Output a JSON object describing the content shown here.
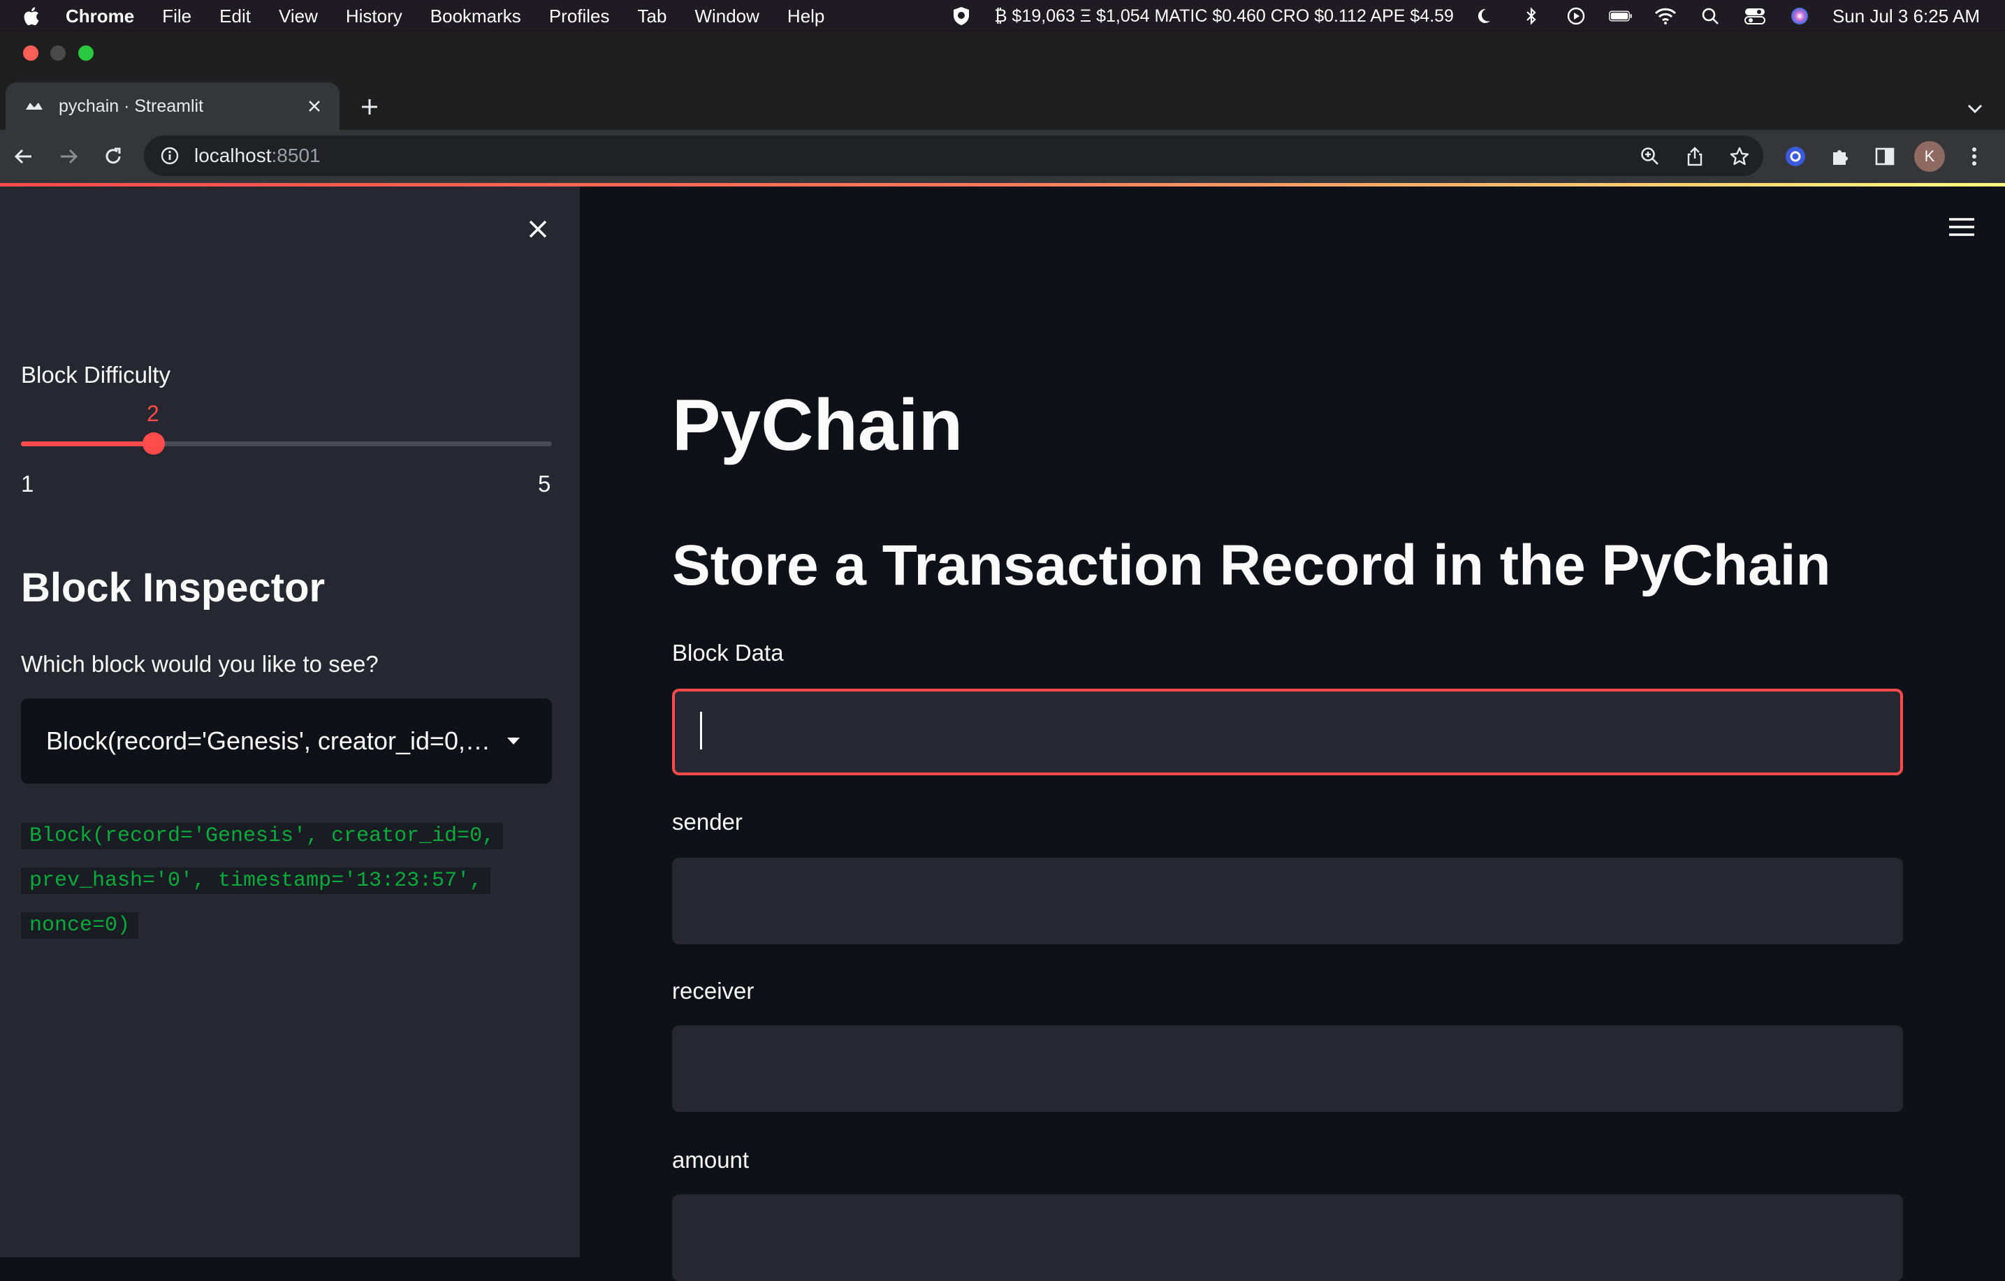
{
  "menubar": {
    "app_name": "Chrome",
    "items": [
      "File",
      "Edit",
      "View",
      "History",
      "Bookmarks",
      "Profiles",
      "Tab",
      "Window",
      "Help"
    ],
    "ticker": "₿ $19,063 Ξ $1,054 MATIC $0.460 CRO $0.112 APE $4.59",
    "clock": "Sun Jul 3  6:25 AM"
  },
  "browser": {
    "tab_title": "pychain · Streamlit",
    "url_host": "localhost",
    "url_port": ":8501",
    "avatar_initial": "K"
  },
  "sidebar": {
    "difficulty_label": "Block Difficulty",
    "difficulty_value": "2",
    "difficulty_min": "1",
    "difficulty_max": "5",
    "difficulty_fraction": 0.25,
    "inspector_heading": "Block Inspector",
    "select_label": "Which block would you like to see?",
    "select_value": "Block(record='Genesis', creator_id=0, prev_hash='0', timestamp='13:23:57', nonce=0)",
    "code_lines": [
      "Block(record='Genesis', creator_id=0,",
      "prev_hash='0', timestamp='13:23:57',",
      "nonce=0)"
    ]
  },
  "main": {
    "title": "PyChain",
    "subtitle": "Store a Transaction Record in the PyChain",
    "fields": [
      {
        "label": "Block Data",
        "value": ""
      },
      {
        "label": "sender",
        "value": ""
      },
      {
        "label": "receiver",
        "value": ""
      },
      {
        "label": "amount",
        "value": ""
      }
    ]
  },
  "colors": {
    "accent": "#ff4b4b",
    "background": "#0e1117",
    "sidebar": "#262730",
    "code_text": "#09ab3b"
  }
}
